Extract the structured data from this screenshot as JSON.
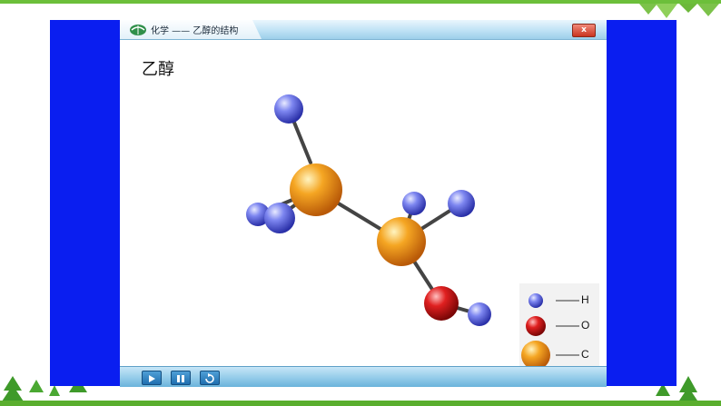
{
  "window": {
    "title": "化学 —— 乙醇的结构",
    "close_label": "x"
  },
  "content": {
    "page_title": "乙醇"
  },
  "legend": {
    "items": [
      {
        "element": "H",
        "color": "#5b66e0"
      },
      {
        "element": "O",
        "color": "#d62020"
      },
      {
        "element": "C",
        "color": "#f2a020"
      }
    ]
  },
  "controls": {
    "play_icon": "play-icon",
    "pause_icon": "pause-icon",
    "replay_icon": "replay-icon"
  },
  "colors": {
    "frame_blue": "#0a1ef0",
    "accent_green": "#6cbf3a"
  }
}
